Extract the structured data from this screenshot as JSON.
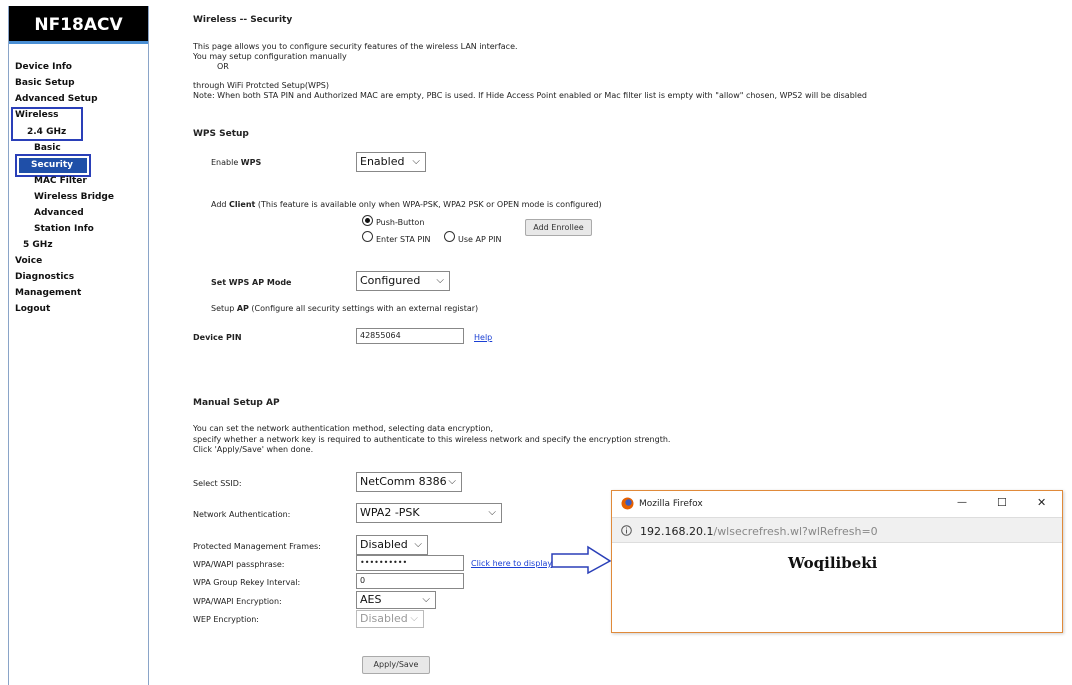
{
  "sidebar": {
    "brand": "NF18ACV",
    "items": {
      "device_info": "Device Info",
      "basic_setup": "Basic Setup",
      "advanced_setup": "Advanced Setup",
      "wireless": "Wireless",
      "ghz24": "2.4 GHz",
      "basic": "Basic",
      "security": "Security",
      "mac_filter": "MAC Filter",
      "wireless_bridge": "Wireless Bridge",
      "advanced": "Advanced",
      "station_info": "Station Info",
      "ghz5": "5 GHz",
      "voice": "Voice",
      "diagnostics": "Diagnostics",
      "management": "Management",
      "logout": "Logout"
    }
  },
  "page": {
    "title": "Wireless -- Security",
    "intro1": "This page allows you to configure security features of the wireless LAN interface.",
    "intro2": "You may setup configuration manually",
    "intro3": "OR",
    "intro4": "through WiFi Protcted Setup(WPS)",
    "intro5": "Note: When both STA PIN and Authorized MAC are empty, PBC is used. If Hide Access Point enabled or Mac filter list is empty with \"allow\" chosen, WPS2 will be disabled"
  },
  "wps": {
    "heading": "WPS Setup",
    "enable_label_pre": "Enable ",
    "enable_label_bold": "WPS",
    "enable_value": "Enabled",
    "add_client_pre": "Add ",
    "add_client_bold": "Client",
    "add_client_post": " (This feature is available only when WPA-PSK, WPA2 PSK or OPEN mode is configured)",
    "push_button": "Push-Button",
    "enter_sta_pin": "Enter STA PIN",
    "use_ap_pin": "Use AP PIN",
    "add_enrollee": "Add Enrollee",
    "ap_mode_label": "Set WPS AP Mode",
    "ap_mode_value": "Configured",
    "setup_ap_pre": "Setup ",
    "setup_ap_bold": "AP",
    "setup_ap_post": " (Configure all security settings with an external registar)",
    "device_pin_label": "Device PIN",
    "device_pin_value": "42855064",
    "help": "Help"
  },
  "manual": {
    "heading": "Manual Setup AP",
    "desc1": "You can set the network authentication method, selecting data encryption,",
    "desc2": "specify whether a network key is required to authenticate to this wireless network and specify the encryption strength.",
    "desc3": "Click 'Apply/Save' when done.",
    "ssid_label": "Select SSID:",
    "ssid_value": "NetComm 8386",
    "auth_label": "Network Authentication:",
    "auth_value": "WPA2 -PSK",
    "pmf_label": "Protected Management Frames:",
    "pmf_value": "Disabled",
    "pass_label": "WPA/WAPI passphrase:",
    "pass_value": "••••••••••",
    "click_display": "Click here to display",
    "rekey_label": "WPA Group Rekey Interval:",
    "rekey_value": "0",
    "enc_label": "WPA/WAPI Encryption:",
    "enc_value": "AES",
    "wep_label": "WEP Encryption:",
    "wep_value": "Disabled",
    "apply": "Apply/Save"
  },
  "popup": {
    "window_title": "Mozilla Firefox",
    "url_host": "192.168.20.1",
    "url_path": "/wlsecrefresh.wl?wlRefresh=0",
    "content": "Woqilibeki",
    "minimize": "—",
    "maximize": "☐",
    "close": "✕"
  }
}
